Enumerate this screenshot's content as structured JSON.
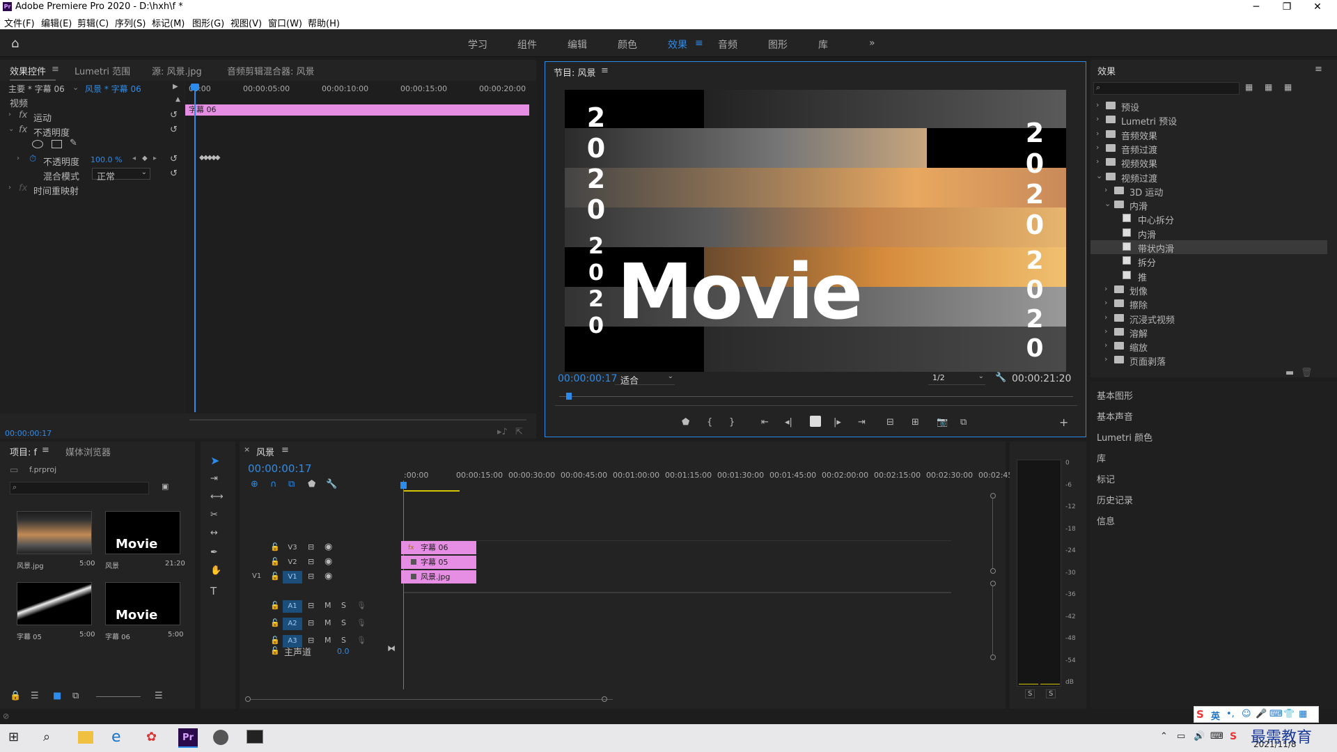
{
  "window": {
    "title": "Adobe Premiere Pro 2020 - D:\\hxh\\f *",
    "app_icon": "Pr"
  },
  "menu": [
    "文件(F)",
    "编辑(E)",
    "剪辑(C)",
    "序列(S)",
    "标记(M)",
    "图形(G)",
    "视图(V)",
    "窗口(W)",
    "帮助(H)"
  ],
  "workspaces": [
    "学习",
    "组件",
    "编辑",
    "颜色",
    "效果",
    "音频",
    "图形",
    "库"
  ],
  "workspace_active": "效果",
  "effect_controls": {
    "tabs": [
      "效果控件",
      "Lumetri 范围",
      "源: 风景.jpg",
      "音频剪辑混合器: 风景"
    ],
    "master": "主要 * 字幕 06",
    "clip": "风景 * 字幕 06",
    "ruler": [
      "00:00",
      "00:00:05:00",
      "00:00:10:00",
      "00:00:15:00",
      "00:00:20:00"
    ],
    "clip_bar": "字幕 06",
    "section": "视频",
    "motion": "运动",
    "opacity": "不透明度",
    "opacity_prop": "不透明度",
    "opacity_value": "100.0 %",
    "blend_label": "混合模式",
    "blend_value": "正常",
    "time_remap": "时间重映射",
    "timecode": "00:00:00:17"
  },
  "program": {
    "title": "节目: 风景",
    "timecode": "00:00:00:17",
    "fit": "适合",
    "quality": "1/2",
    "duration": "00:00:21:20",
    "big_text": "Movie",
    "year_digits": [
      "2",
      "0",
      "2",
      "0"
    ]
  },
  "effects": {
    "title": "效果",
    "items": [
      {
        "label": "预设",
        "level": 0,
        "type": "folder",
        "open": false
      },
      {
        "label": "Lumetri 预设",
        "level": 0,
        "type": "folder",
        "open": false
      },
      {
        "label": "音频效果",
        "level": 0,
        "type": "folder",
        "open": false
      },
      {
        "label": "音频过渡",
        "level": 0,
        "type": "folder",
        "open": false
      },
      {
        "label": "视频效果",
        "level": 0,
        "type": "folder",
        "open": false
      },
      {
        "label": "视频过渡",
        "level": 0,
        "type": "folder",
        "open": true
      },
      {
        "label": "3D 运动",
        "level": 1,
        "type": "folder",
        "open": false
      },
      {
        "label": "内滑",
        "level": 1,
        "type": "folder",
        "open": true
      },
      {
        "label": "中心拆分",
        "level": 2,
        "type": "effect"
      },
      {
        "label": "内滑",
        "level": 2,
        "type": "effect"
      },
      {
        "label": "带状内滑",
        "level": 2,
        "type": "effect",
        "selected": true
      },
      {
        "label": "拆分",
        "level": 2,
        "type": "effect"
      },
      {
        "label": "推",
        "level": 2,
        "type": "effect"
      },
      {
        "label": "划像",
        "level": 1,
        "type": "folder",
        "open": false
      },
      {
        "label": "擦除",
        "level": 1,
        "type": "folder",
        "open": false
      },
      {
        "label": "沉浸式视频",
        "level": 1,
        "type": "folder",
        "open": false
      },
      {
        "label": "溶解",
        "level": 1,
        "type": "folder",
        "open": false
      },
      {
        "label": "缩放",
        "level": 1,
        "type": "folder",
        "open": false
      },
      {
        "label": "页面剥落",
        "level": 1,
        "type": "folder",
        "open": false
      }
    ],
    "side_panels": [
      "基本图形",
      "基本声音",
      "Lumetri 颜色",
      "库",
      "标记",
      "历史记录",
      "信息"
    ]
  },
  "project": {
    "tabs": [
      "项目: f",
      "媒体浏览器"
    ],
    "file": "f.prproj",
    "items": [
      {
        "name": "风景.jpg",
        "dur": "5:00"
      },
      {
        "name": "风景",
        "dur": "21:20"
      },
      {
        "name": "字幕 05",
        "dur": "5:00"
      },
      {
        "name": "字幕 06",
        "dur": "5:00"
      }
    ],
    "thumb_text": "Movie"
  },
  "timeline": {
    "tab": "风景",
    "timecode": "00:00:00:17",
    "ruler": [
      ":00:00",
      "00:00:15:00",
      "00:00:30:00",
      "00:00:45:00",
      "00:01:00:00",
      "00:01:15:00",
      "00:01:30:00",
      "00:01:45:00",
      "00:02:00:00",
      "00:02:15:00",
      "00:02:30:00",
      "00:02:45:"
    ],
    "tracks_video": [
      "V3",
      "V2",
      "V1"
    ],
    "src_patch": "V1",
    "tracks_audio": [
      "A1",
      "A2",
      "A3"
    ],
    "track_m": "M",
    "track_s": "S",
    "master_label": "主声道",
    "master_value": "0.0",
    "clips": [
      {
        "label": "字幕 06",
        "track": "V3"
      },
      {
        "label": "字幕 05",
        "track": "V2"
      },
      {
        "label": "风景.jpg",
        "track": "V1"
      }
    ]
  },
  "meter": {
    "labels": [
      "0",
      "-6",
      "-12",
      "-18",
      "-24",
      "-30",
      "-36",
      "-42",
      "-48",
      "-54",
      "dB"
    ],
    "solo": [
      "S",
      "S"
    ]
  },
  "taskbar": {
    "ime": "英",
    "date": "2021/11/8",
    "watermark": "最需教育"
  },
  "colors": {
    "accent": "#2d8ceb",
    "clip_pink": "#e58ee3",
    "bg": "#1d1d1d"
  }
}
